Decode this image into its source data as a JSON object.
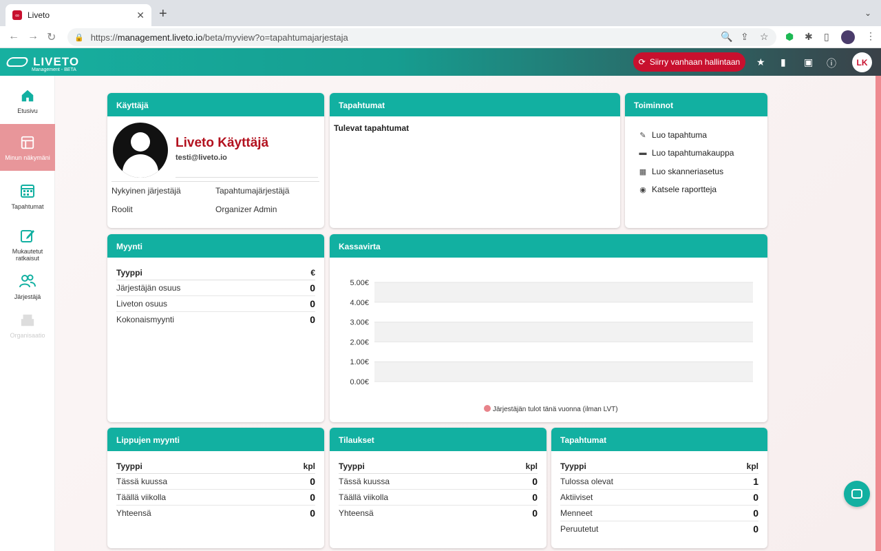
{
  "browser": {
    "tab_title": "Liveto",
    "url_host": "management.liveto.io",
    "url_prefix": "https://",
    "url_path": "/beta/myview?o=tapahtumajarjestaja"
  },
  "header": {
    "logo_text": "LIVETO",
    "logo_sub": "Management - BETA",
    "old_button": "Siirry vanhaan hallintaan",
    "user_initials": "LK"
  },
  "sidebar": {
    "items": [
      {
        "label": "Etusivu"
      },
      {
        "label": "Minun näkymäni"
      },
      {
        "label": "Tapahtumat"
      },
      {
        "label": "Mukautetut ratkaisut"
      },
      {
        "label": "Järjestäjä"
      },
      {
        "label": "Organisaatio"
      }
    ]
  },
  "user_card": {
    "title": "Käyttäjä",
    "name": "Liveto Käyttäjä",
    "email": "testi@liveto.io",
    "organizer_label": "Nykyinen järjestäjä",
    "organizer_value": "Tapahtumajärjestäjä",
    "roles_label": "Roolit",
    "roles_value": "Organizer Admin"
  },
  "events_card": {
    "title": "Tapahtumat",
    "upcoming": "Tulevat tapahtumat"
  },
  "actions_card": {
    "title": "Toiminnot",
    "items": [
      "Luo tapahtuma",
      "Luo tapahtumakauppa",
      "Luo skanneriasetus",
      "Katsele raportteja"
    ]
  },
  "sales_card": {
    "title": "Myynti",
    "col_type": "Tyyppi",
    "col_unit": "€",
    "rows": [
      {
        "label": "Järjestäjän osuus",
        "value": "0"
      },
      {
        "label": "Liveton osuus",
        "value": "0"
      },
      {
        "label": "Kokonaismyynti",
        "value": "0"
      }
    ]
  },
  "cashflow_card": {
    "title": "Kassavirta"
  },
  "chart_data": {
    "type": "bar",
    "title": "",
    "categories": [],
    "series": [
      {
        "name": "Järjestäjän tulot tänä vuonna (ilman LVT)",
        "values": []
      }
    ],
    "y_ticks": [
      "0.00€",
      "1.00€",
      "2.00€",
      "3.00€",
      "4.00€",
      "5.00€"
    ],
    "ylim": [
      0,
      5
    ],
    "grid": true,
    "legend": "bottom",
    "series_color": "#e8838a"
  },
  "tickets_card": {
    "title": "Lippujen myynti",
    "col_type": "Tyyppi",
    "col_unit": "kpl",
    "rows": [
      {
        "label": "Tässä kuussa",
        "value": "0"
      },
      {
        "label": "Täällä viikolla",
        "value": "0"
      },
      {
        "label": "Yhteensä",
        "value": "0"
      }
    ]
  },
  "orders_card": {
    "title": "Tilaukset",
    "col_type": "Tyyppi",
    "col_unit": "kpl",
    "rows": [
      {
        "label": "Tässä kuussa",
        "value": "0"
      },
      {
        "label": "Täällä viikolla",
        "value": "0"
      },
      {
        "label": "Yhteensä",
        "value": "0"
      }
    ]
  },
  "events_stats_card": {
    "title": "Tapahtumat",
    "col_type": "Tyyppi",
    "col_unit": "kpl",
    "rows": [
      {
        "label": "Tulossa olevat",
        "value": "1"
      },
      {
        "label": "Aktiiviset",
        "value": "0"
      },
      {
        "label": "Menneet",
        "value": "0"
      },
      {
        "label": "Peruutetut",
        "value": "0"
      }
    ]
  },
  "colors": {
    "teal": "#12b0a1",
    "brand_red": "#c8102e"
  }
}
